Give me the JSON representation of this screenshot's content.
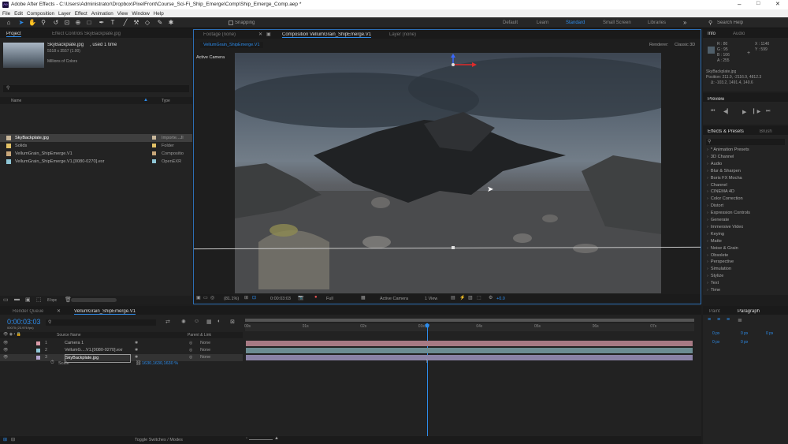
{
  "window": {
    "title": "Adobe After Effects - C:\\Users\\Administrator\\Dropbox\\PixelFront\\Course_Sci-Fi_Ship_Emerge\\Comp\\Ship_Emerge_Comp.aep *",
    "controls": [
      "–",
      "□",
      "✕"
    ]
  },
  "menu": [
    "File",
    "Edit",
    "Composition",
    "Layer",
    "Effect",
    "Animation",
    "View",
    "Window",
    "Help"
  ],
  "toolbar": {
    "snapping_label": "Snapping",
    "workspaces": [
      "Default",
      "Learn",
      "Standard",
      "Small Screen",
      "Libraries"
    ],
    "active_workspace": "Standard",
    "search_placeholder": "Search Help"
  },
  "project": {
    "tab": "Project",
    "effect_controls_tab": "Effect Controls SkyBackplate.jpg",
    "asset_name": "SkyBackplate.jpg",
    "asset_used": ", used 1 time",
    "asset_dims": "5518 x 3557 (1.00)",
    "asset_colors": "Millions of Colors",
    "col_name": "Name",
    "col_type": "Type",
    "items": [
      {
        "name": "SkyBackplate.jpg",
        "type": "Importe...Jl",
        "color": "#c9b79a",
        "selected": true
      },
      {
        "name": "Solids",
        "type": "Folder",
        "color": "#e3c266",
        "selected": false
      },
      {
        "name": "VellumGrain_ShipEmerge.V1",
        "type": "Compositio",
        "color": "#c9a77a",
        "selected": false
      },
      {
        "name": "VellumGrain_ShipEmerge.V1.[0080-0270].exr",
        "type": "OpenEXR",
        "color": "#8fc6d6",
        "selected": false
      }
    ],
    "bpc": "8 bpc"
  },
  "viewer": {
    "tab_footage": "Footage (none)",
    "tab_comp": "Composition VellumGrain_ShipEmerge.V1",
    "tab_layer": "Layer (none)",
    "comp_chip": "VellumGrain_ShipEmerge.V1",
    "renderer_label": "Renderer:",
    "renderer_value": "Classic 3D",
    "active_camera_label": "Active Camera",
    "zoom": "(81.1%)",
    "timecode": "0:00:03:03",
    "resolution": "Full",
    "view_mode": "Active Camera",
    "view_count": "1 View",
    "exposure": "+0.0"
  },
  "info": {
    "tab": "Info",
    "audio_tab": "Audio",
    "r": "R : 80",
    "g": "G : 95",
    "b": "B : 106",
    "a": "A : 255",
    "x": "X : 1140",
    "y": "Y : 599",
    "file": "SkyBackplate.jpg",
    "position": "Position: 211.9, -2116.9, 4812.3",
    "delta": "Δ: -103.2, 1491.4, 140.6"
  },
  "preview": {
    "tab": "Preview"
  },
  "effects": {
    "tab": "Effects & Presets",
    "brush_tab": "Brush",
    "items": [
      "* Animation Presets",
      "3D Channel",
      "Audio",
      "Blur & Sharpen",
      "Boris FX Mocha",
      "Channel",
      "CINEMA 4D",
      "Color Correction",
      "Distort",
      "Expression Controls",
      "Generate",
      "Immersive Video",
      "Keying",
      "Matte",
      "Noise & Grain",
      "Obsolete",
      "Perspective",
      "Simulation",
      "Stylize",
      "Text",
      "Time"
    ]
  },
  "paragraph": {
    "paint_tab": "Paint",
    "paragraph_tab": "Paragraph",
    "fields": [
      "0 px",
      "0 px",
      "0 px",
      "0 px",
      "0 px"
    ]
  },
  "timeline": {
    "render_queue_tab": "Render Queue",
    "comp_tab": "VellumGrain_ShipEmerge.V1",
    "timecode": "0:00:03:03",
    "frame_info": "00075 (23.976 fps)",
    "col_source": "Source Name",
    "col_parent": "Parent & Link",
    "ticks": [
      "00s",
      "01s",
      "02s",
      "03s",
      "04s",
      "05s",
      "06s",
      "07s"
    ],
    "layers": [
      {
        "num": "1",
        "name": "Camera 1",
        "parent": "None",
        "color": "#d99aa8",
        "bar": "#a77a84"
      },
      {
        "num": "2",
        "name": "VellumG....V1.[0080-0270].exr",
        "parent": "None",
        "color": "#8fc6d6",
        "bar": "#6c8c92"
      },
      {
        "num": "3",
        "name": "SkyBackplate.jpg",
        "parent": "None",
        "color": "#b5a6cf",
        "bar": "#8a82a6"
      }
    ],
    "scale_label": "Scale",
    "scale_value": "1630,1630,1630 %",
    "toggle_label": "Toggle Switches / Modes"
  },
  "colors": {
    "accent": "#2d8ceb",
    "panel": "#232323",
    "header": "#1a1a1a"
  }
}
